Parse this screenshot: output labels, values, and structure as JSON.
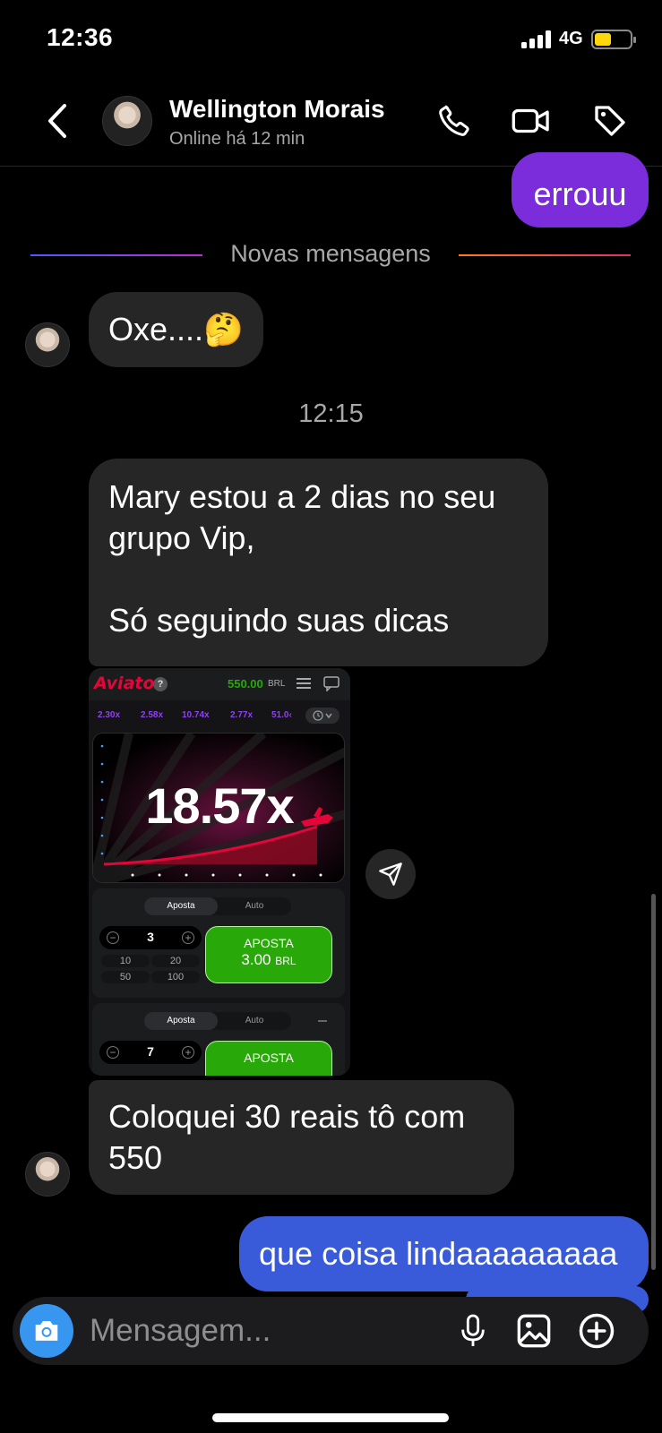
{
  "status_bar": {
    "time": "12:36",
    "network": "4G"
  },
  "header": {
    "contact_name": "Wellington Morais",
    "contact_status": "Online há 12 min"
  },
  "divider_label": "Novas mensagens",
  "timestamp": "12:15",
  "messages": [
    {
      "text": "errouu"
    },
    {
      "text": "Oxe....🤔"
    },
    {
      "lines": [
        "Mary estou a 2  dias no seu",
        "grupo Vip,",
        "",
        "Só seguindo suas dicas"
      ]
    },
    {
      "lines": [
        "Coloquei 30 reais tô com",
        "550"
      ]
    },
    {
      "text": "que coisa lindaaaaaaaaa"
    }
  ],
  "game_screenshot": {
    "logo": "Aviator",
    "help": "?",
    "balance": "550.00",
    "currency": "BRL",
    "odds": [
      "2.30x",
      "2.58x",
      "10.74x",
      "2.77x",
      "51.0‹"
    ],
    "multiplier": "18.57x",
    "panels": [
      {
        "tab_active": "Aposta",
        "tab_inactive": "Auto",
        "stepper_value": "3",
        "quick": [
          "10",
          "20",
          "50",
          "100"
        ],
        "bet_label": "APOSTA",
        "bet_amount": "3.00",
        "bet_currency": "BRL"
      },
      {
        "tab_active": "Aposta",
        "tab_inactive": "Auto",
        "stepper_value": "7",
        "bet_label": "APOSTA"
      }
    ]
  },
  "composer": {
    "placeholder": "Mensagem..."
  },
  "colors": {
    "outgoing_purple": "#7b2cdb",
    "outgoing_blue": "#3a5bd9",
    "incoming": "#262626",
    "accent": "#3797f0",
    "game_green": "#28a909",
    "game_red": "#e50539"
  }
}
